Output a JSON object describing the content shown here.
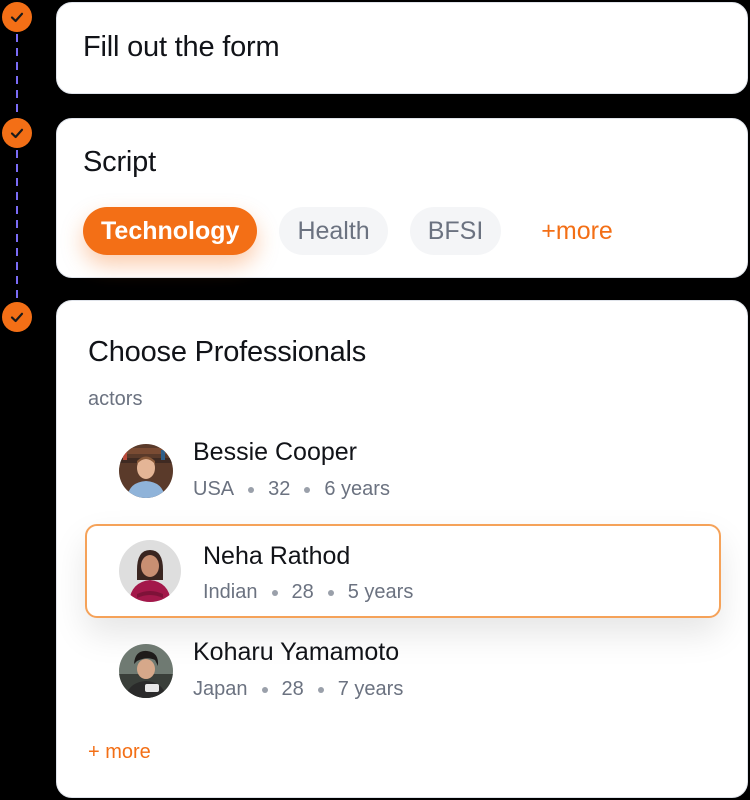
{
  "theme": {
    "accent": "#f36f16",
    "timeline_line": "#7b6cf6",
    "card_bg": "#ffffff"
  },
  "steps": [
    {
      "icon": "check-icon",
      "status": "complete"
    },
    {
      "icon": "check-icon",
      "status": "complete"
    },
    {
      "icon": "check-icon",
      "status": "complete"
    }
  ],
  "form_step": {
    "title": "Fill out the form"
  },
  "script_step": {
    "title": "Script",
    "chips": [
      {
        "label": "Technology",
        "selected": true
      },
      {
        "label": "Health",
        "selected": false
      },
      {
        "label": "BFSI",
        "selected": false
      }
    ],
    "more_label": "+more"
  },
  "professionals_step": {
    "title": "Choose Professionals",
    "subtitle": "actors",
    "people": [
      {
        "name": "Bessie Cooper",
        "country": "USA",
        "age": "32",
        "experience": "6 years",
        "selected": false
      },
      {
        "name": "Neha Rathod",
        "country": "Indian",
        "age": "28",
        "experience": "5 years",
        "selected": true
      },
      {
        "name": "Koharu Yamamoto",
        "country": "Japan",
        "age": "28",
        "experience": "7 years",
        "selected": false
      }
    ],
    "more_label": "+ more"
  }
}
